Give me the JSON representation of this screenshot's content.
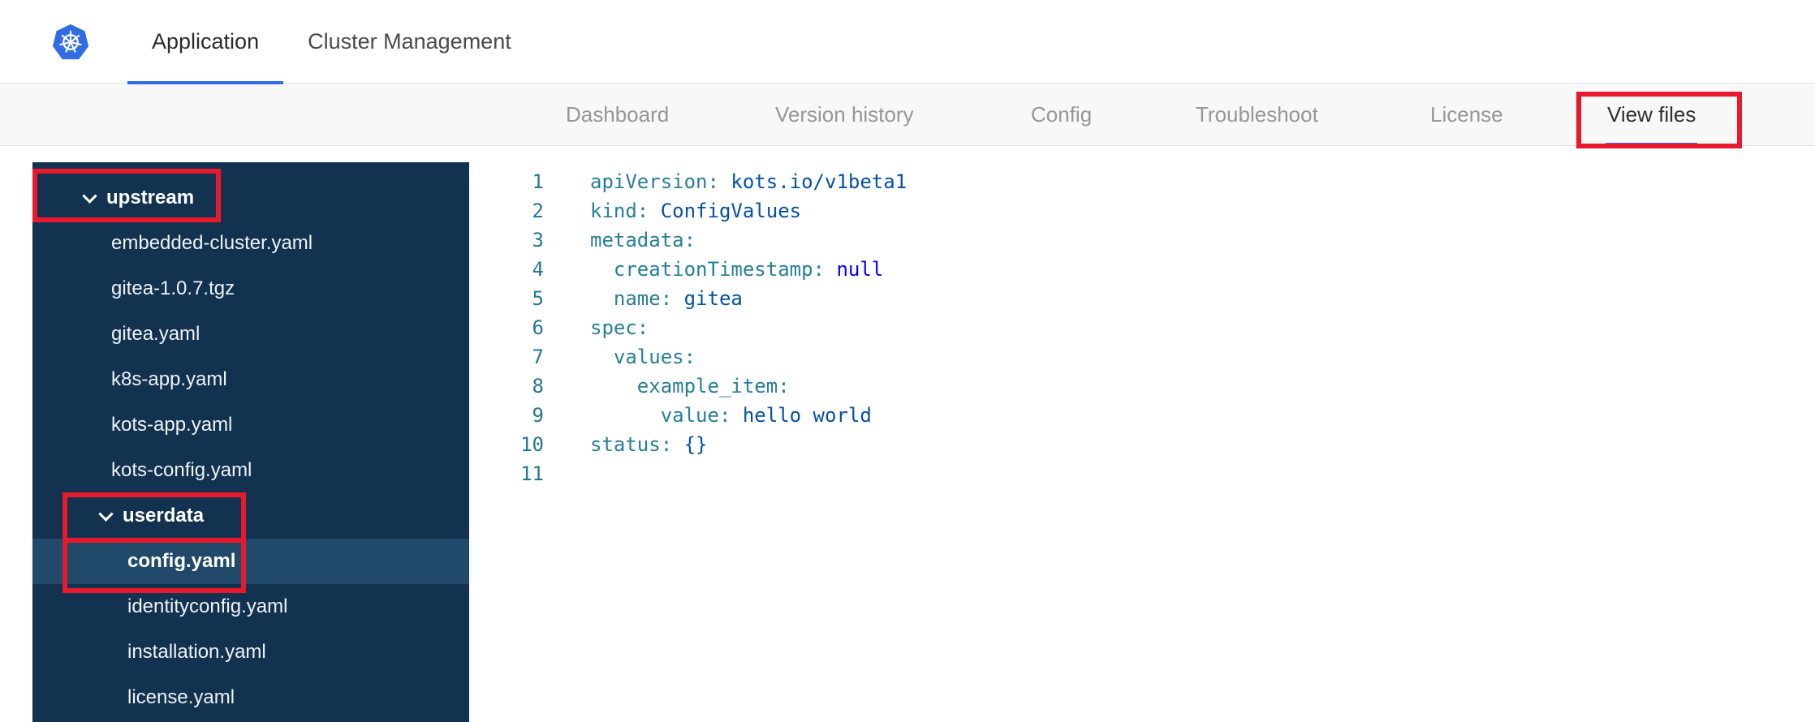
{
  "colors": {
    "accent_blue": "#326de6",
    "nav_bg": "#f8f8f8",
    "sidebar_bg": "#123250",
    "sidebar_selected_bg": "#20496a",
    "annotation_red": "#e8192c",
    "code_key": "#267f99",
    "code_value": "#0451a5",
    "code_keyword": "#0000ff",
    "line_number": "#237893"
  },
  "header": {
    "logo_icon": "kubernetes-logo",
    "tabs": [
      {
        "label": "Application",
        "active": true
      },
      {
        "label": "Cluster Management",
        "active": false
      }
    ]
  },
  "nav": {
    "items": [
      {
        "label": "Dashboard",
        "active": false
      },
      {
        "label": "Version history",
        "active": false
      },
      {
        "label": "Config",
        "active": false
      },
      {
        "label": "Troubleshoot",
        "active": false
      },
      {
        "label": "License",
        "active": false
      },
      {
        "label": "View files",
        "active": true,
        "annotated": true
      }
    ]
  },
  "file_tree": {
    "items": [
      {
        "type": "folder",
        "label": "upstream",
        "level": 0,
        "expanded": true,
        "annotated": true,
        "selected": false
      },
      {
        "type": "file",
        "label": "embedded-cluster.yaml",
        "level": 1,
        "selected": false
      },
      {
        "type": "file",
        "label": "gitea-1.0.7.tgz",
        "level": 1,
        "selected": false
      },
      {
        "type": "file",
        "label": "gitea.yaml",
        "level": 1,
        "selected": false
      },
      {
        "type": "file",
        "label": "k8s-app.yaml",
        "level": 1,
        "selected": false
      },
      {
        "type": "file",
        "label": "kots-app.yaml",
        "level": 1,
        "selected": false
      },
      {
        "type": "file",
        "label": "kots-config.yaml",
        "level": 1,
        "selected": false
      },
      {
        "type": "folder",
        "label": "userdata",
        "level": 1,
        "expanded": true,
        "annotated": true,
        "selected": false
      },
      {
        "type": "file",
        "label": "config.yaml",
        "level": 2,
        "selected": true,
        "annotated": true
      },
      {
        "type": "file",
        "label": "identityconfig.yaml",
        "level": 2,
        "selected": false
      },
      {
        "type": "file",
        "label": "installation.yaml",
        "level": 2,
        "selected": false
      },
      {
        "type": "file",
        "label": "license.yaml",
        "level": 2,
        "selected": false
      }
    ]
  },
  "editor": {
    "language": "yaml",
    "lines": [
      {
        "n": 1,
        "tokens": [
          [
            "key",
            "apiVersion:"
          ],
          [
            "value",
            " kots.io/v1beta1"
          ]
        ]
      },
      {
        "n": 2,
        "tokens": [
          [
            "key",
            "kind:"
          ],
          [
            "value",
            " ConfigValues"
          ]
        ]
      },
      {
        "n": 3,
        "tokens": [
          [
            "key",
            "metadata:"
          ]
        ]
      },
      {
        "n": 4,
        "tokens": [
          [
            "plain",
            "  "
          ],
          [
            "key",
            "creationTimestamp:"
          ],
          [
            "keyword",
            " null"
          ]
        ]
      },
      {
        "n": 5,
        "tokens": [
          [
            "plain",
            "  "
          ],
          [
            "key",
            "name:"
          ],
          [
            "value",
            " gitea"
          ]
        ]
      },
      {
        "n": 6,
        "tokens": [
          [
            "key",
            "spec:"
          ]
        ]
      },
      {
        "n": 7,
        "tokens": [
          [
            "plain",
            "  "
          ],
          [
            "key",
            "values:"
          ]
        ]
      },
      {
        "n": 8,
        "tokens": [
          [
            "plain",
            "    "
          ],
          [
            "key",
            "example_item:"
          ]
        ]
      },
      {
        "n": 9,
        "tokens": [
          [
            "plain",
            "      "
          ],
          [
            "key",
            "value:"
          ],
          [
            "value",
            " hello world"
          ]
        ]
      },
      {
        "n": 10,
        "tokens": [
          [
            "key",
            "status:"
          ],
          [
            "value",
            " {}"
          ]
        ]
      },
      {
        "n": 11,
        "tokens": []
      }
    ]
  }
}
